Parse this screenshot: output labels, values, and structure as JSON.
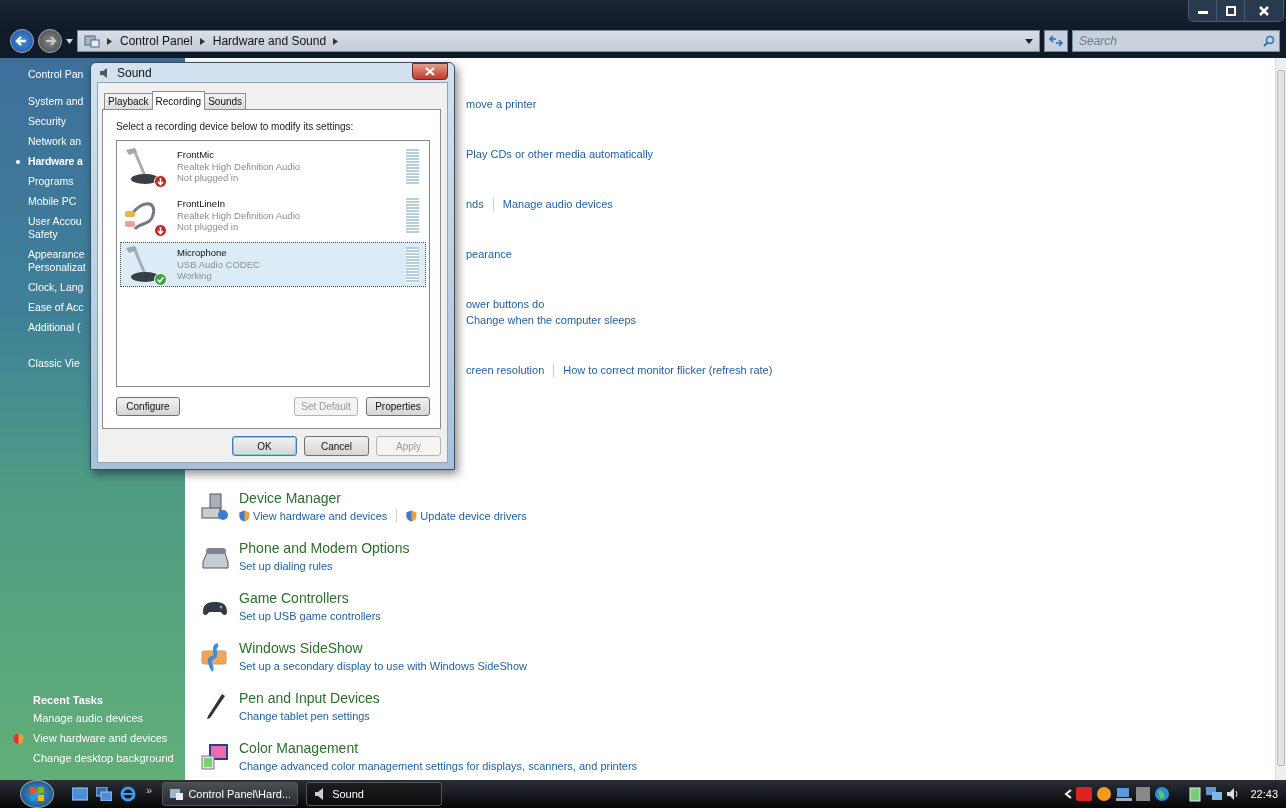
{
  "window": {
    "breadcrumbs": [
      "Control Panel",
      "Hardware and Sound"
    ],
    "search": {
      "placeholder": "Search"
    }
  },
  "sidebar": {
    "home": "Control Pan",
    "items": [
      {
        "label": "System and",
        "selected": false
      },
      {
        "label": "Security",
        "selected": false
      },
      {
        "label": "Network an",
        "selected": false
      },
      {
        "label": "Hardware a",
        "selected": true
      },
      {
        "label": "Programs",
        "selected": false
      },
      {
        "label": "Mobile PC",
        "selected": false
      },
      {
        "label": "User Accou\nSafety",
        "selected": false
      },
      {
        "label": "Appearance\nPersonalizat",
        "selected": false
      },
      {
        "label": "Clock, Lang",
        "selected": false
      },
      {
        "label": "Ease of Acc",
        "selected": false
      },
      {
        "label": "Additional (",
        "selected": false
      }
    ],
    "classic_view": "Classic Vie",
    "recent_tasks": {
      "title": "Recent Tasks",
      "items": [
        {
          "label": "Manage audio devices",
          "shield": false
        },
        {
          "label": "View hardware and devices",
          "shield": true
        },
        {
          "label": "Change desktop background",
          "shield": false
        }
      ]
    }
  },
  "main": {
    "partial_rows": [
      {
        "lines": [
          [
            "move a printer"
          ]
        ]
      },
      {
        "lines": [
          [
            "Play CDs or other media automatically"
          ]
        ]
      },
      {
        "lines": [
          [
            "nds",
            "Manage audio devices"
          ]
        ]
      },
      {
        "lines": [
          [
            "pearance"
          ]
        ]
      },
      {
        "lines": [
          [
            "ower buttons do"
          ],
          [
            "Change when the computer sleeps"
          ]
        ]
      },
      {
        "lines": [
          [
            "creen resolution",
            "How to correct monitor flicker (refresh rate)"
          ]
        ]
      }
    ],
    "sections": [
      {
        "kind": "computer",
        "title": "Device Manager",
        "links": [
          {
            "label": "View hardware and devices",
            "shield": true
          },
          {
            "label": "Update device drivers",
            "shield": true
          }
        ]
      },
      {
        "kind": "phone",
        "title": "Phone and Modem Options",
        "links": [
          {
            "label": "Set up dialing rules",
            "shield": false
          }
        ]
      },
      {
        "kind": "gamepad",
        "title": "Game Controllers",
        "links": [
          {
            "label": "Set up USB game controllers",
            "shield": false
          }
        ]
      },
      {
        "kind": "sideshow",
        "title": "Windows SideShow",
        "links": [
          {
            "label": "Set up a secondary display to use with Windows SideShow",
            "shield": false
          }
        ]
      },
      {
        "kind": "pen",
        "title": "Pen and Input Devices",
        "links": [
          {
            "label": "Change tablet pen settings",
            "shield": false
          }
        ]
      },
      {
        "kind": "color",
        "title": "Color Management",
        "links": [
          {
            "label": "Change advanced color management settings for displays, scanners, and printers",
            "shield": false
          }
        ]
      }
    ]
  },
  "dialog": {
    "title": "Sound",
    "tabs": [
      {
        "label": "Playback",
        "selected": false
      },
      {
        "label": "Recording",
        "selected": true
      },
      {
        "label": "Sounds",
        "selected": false
      }
    ],
    "instruction": "Select a recording device below to modify its settings:",
    "devices": [
      {
        "kind": "mic",
        "name": "FrontMic",
        "driver": "Realtek High Definition Audio",
        "status": "Not plugged in",
        "plugged_in": false,
        "selected": false
      },
      {
        "kind": "line",
        "name": "FrontLineIn",
        "driver": "Realtek High Definition Audio",
        "status": "Not plugged in",
        "plugged_in": false,
        "selected": false
      },
      {
        "kind": "mic",
        "name": "Microphone",
        "driver": "USB Audio CODEC",
        "status": "Working",
        "plugged_in": true,
        "selected": true
      }
    ],
    "buttons": [
      {
        "label": "Configure",
        "disabled": false
      },
      {
        "label": "Set Default",
        "disabled": true
      },
      {
        "label": "Properties",
        "disabled": false
      }
    ],
    "footer_buttons": [
      {
        "label": "OK",
        "disabled": false
      },
      {
        "label": "Cancel",
        "disabled": false
      },
      {
        "label": "Apply",
        "disabled": true
      }
    ]
  },
  "taskbar": {
    "more": "»",
    "tasks": [
      {
        "kind": "folder",
        "label": "Control Panel\\Hard...",
        "selected": false
      },
      {
        "kind": "speaker",
        "label": "Sound",
        "selected": true
      }
    ],
    "clock": "22:43"
  }
}
